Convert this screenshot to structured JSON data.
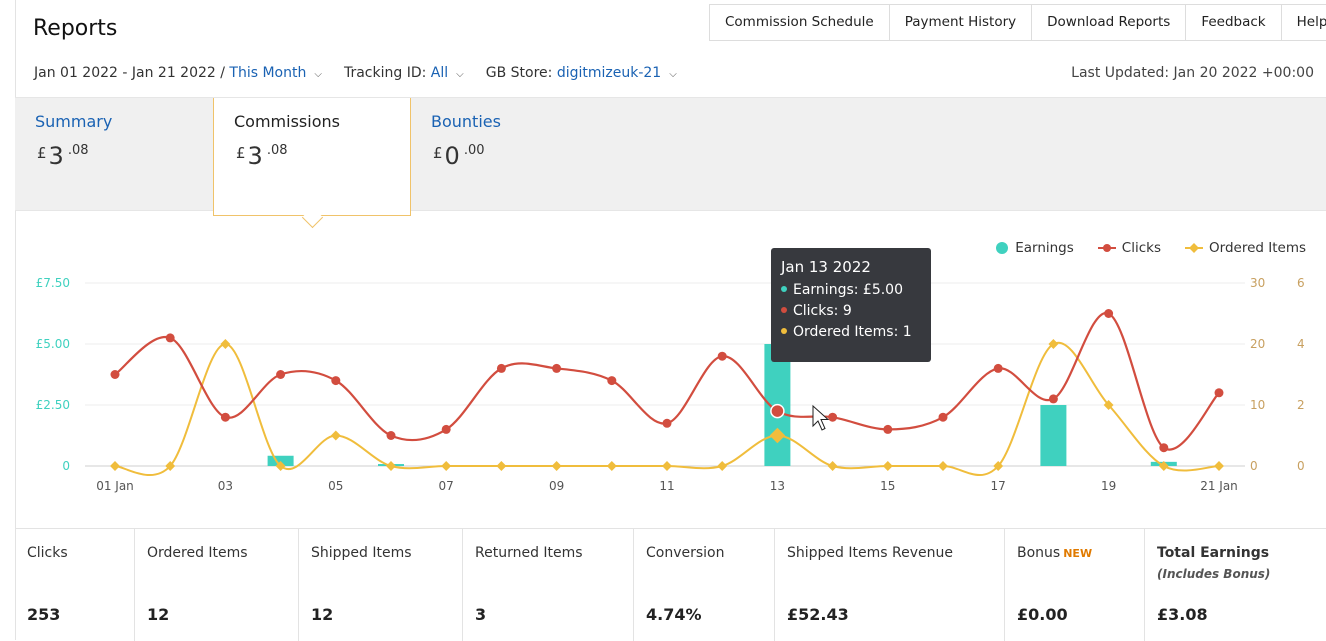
{
  "header": {
    "title": "Reports",
    "links": [
      "Commission Schedule",
      "Payment History",
      "Download Reports",
      "Feedback",
      "Help"
    ]
  },
  "filters": {
    "date_range": "Jan 01 2022 - Jan 21 2022 /",
    "period": "This Month",
    "tracking_label": "Tracking ID:",
    "tracking_value": "All",
    "store_label": "GB Store:",
    "store_value": "digitmizeuk-21",
    "last_updated": "Last Updated: Jan 20 2022 +00:00"
  },
  "tabs": [
    {
      "label": "Summary",
      "currency": "£",
      "whole": "3",
      "decimal": ".08"
    },
    {
      "label": "Commissions",
      "currency": "£",
      "whole": "3",
      "decimal": ".08"
    },
    {
      "label": "Bounties",
      "currency": "£",
      "whole": "0",
      "decimal": ".00"
    }
  ],
  "legend": {
    "earnings": "Earnings",
    "clicks": "Clicks",
    "ordered": "Ordered Items"
  },
  "tooltip": {
    "date": "Jan 13 2022",
    "earnings": "Earnings: £5.00",
    "clicks": "Clicks: 9",
    "ordered": "Ordered Items: 1"
  },
  "chart_data": {
    "type": "line",
    "x": [
      "01 Jan",
      "02",
      "03",
      "04",
      "05",
      "06",
      "07",
      "08",
      "09",
      "10",
      "11",
      "12",
      "13",
      "14",
      "15",
      "16",
      "17",
      "18",
      "19",
      "20",
      "21 Jan"
    ],
    "x_tick_labels": [
      "01 Jan",
      "03",
      "05",
      "07",
      "09",
      "11",
      "13",
      "15",
      "17",
      "19",
      "21 Jan"
    ],
    "y_left_ticks": [
      "0",
      "£2.50",
      "£5.00",
      "£7.50"
    ],
    "y_right1_ticks": [
      "0",
      "10",
      "20",
      "30"
    ],
    "y_right2_ticks": [
      "0",
      "2",
      "4",
      "6"
    ],
    "y_left_range": [
      0,
      7.5
    ],
    "y_right1_range": [
      0,
      30
    ],
    "y_right2_range": [
      0,
      6
    ],
    "series": [
      {
        "name": "Earnings",
        "type": "bar",
        "axis": "left",
        "color": "#3fd1bf",
        "values": [
          0,
          0,
          0,
          0.42,
          0,
          0.08,
          0,
          0,
          0,
          0,
          0,
          0,
          5.0,
          0,
          0,
          0,
          0,
          2.5,
          0,
          0.17,
          0
        ]
      },
      {
        "name": "Clicks",
        "type": "line",
        "axis": "right1",
        "color": "#d24d3f",
        "values": [
          15,
          21,
          8,
          15,
          14,
          5,
          6,
          16,
          16,
          14,
          7,
          18,
          9,
          8,
          6,
          8,
          16,
          11,
          25,
          3,
          12
        ]
      },
      {
        "name": "Ordered Items",
        "type": "line",
        "axis": "right2",
        "color": "#f0bd3c",
        "values": [
          0,
          0,
          4,
          0,
          1,
          0,
          0,
          0,
          0,
          0,
          0,
          0,
          1,
          0,
          0,
          0,
          0,
          4,
          2,
          0,
          0
        ]
      }
    ]
  },
  "stats": [
    {
      "label": "Clicks",
      "value": "253"
    },
    {
      "label": "Ordered Items",
      "value": "12"
    },
    {
      "label": "Shipped Items",
      "value": "12"
    },
    {
      "label": "Returned Items",
      "value": "3"
    },
    {
      "label": "Conversion",
      "value": "4.74%"
    },
    {
      "label": "Shipped Items Revenue",
      "value": "£52.43"
    },
    {
      "label": "Bonus",
      "badge": "NEW",
      "value": "£0.00"
    },
    {
      "label": "Total Earnings",
      "sub": "(Includes Bonus)",
      "value": "£3.08"
    }
  ],
  "colors": {
    "link": "#1a62b3",
    "earnings": "#3fd1bf",
    "clicks": "#d24d3f",
    "ordered": "#f0bd3c",
    "tab_accent": "#f0c36a"
  }
}
